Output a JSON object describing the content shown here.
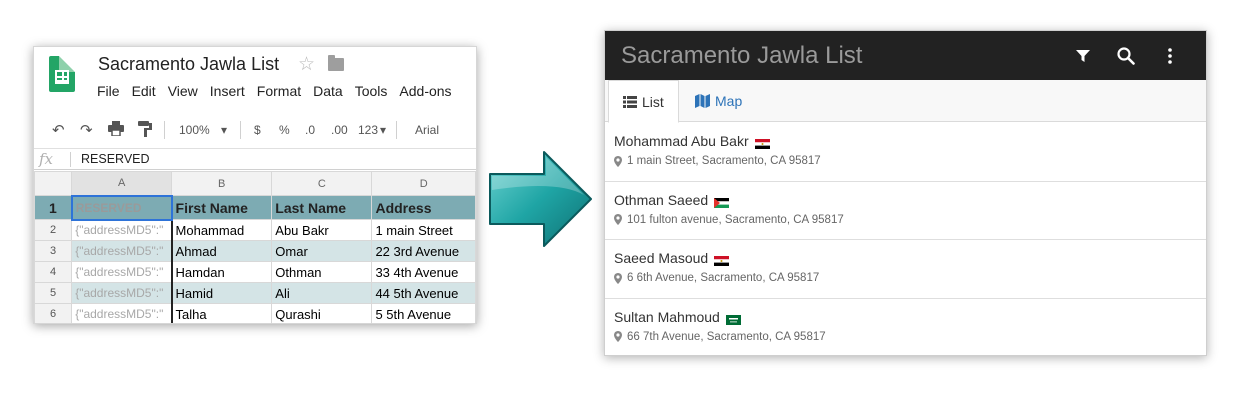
{
  "spreadsheet": {
    "title": "Sacramento Jawla List",
    "menu": [
      "File",
      "Edit",
      "View",
      "Insert",
      "Format",
      "Data",
      "Tools",
      "Add-ons"
    ],
    "toolbar": {
      "zoom": "100%",
      "currency": "$",
      "percent": "%",
      "decrease_decimal": ".0",
      "increase_decimal": ".00",
      "number_format": "123",
      "font": "Arial"
    },
    "formula_bar": {
      "fx": "fx",
      "value": "RESERVED"
    },
    "columns": [
      "A",
      "B",
      "C",
      "D"
    ],
    "header_row": {
      "num": "1",
      "cells": [
        "RESERVED",
        "First Name",
        "Last Name",
        "Address"
      ]
    },
    "rows": [
      {
        "num": "2",
        "cells": [
          "{\"addressMD5\":\"",
          "Mohammad",
          "Abu Bakr",
          "1 main Street"
        ],
        "band": false
      },
      {
        "num": "3",
        "cells": [
          "{\"addressMD5\":\"",
          "Ahmad",
          "Omar",
          "22 3rd Avenue"
        ],
        "band": true
      },
      {
        "num": "4",
        "cells": [
          "{\"addressMD5\":\"",
          "Hamdan",
          "Othman",
          "33 4th Avenue"
        ],
        "band": false
      },
      {
        "num": "5",
        "cells": [
          "{\"addressMD5\":\"",
          "Hamid",
          "Ali",
          "44 5th Avenue"
        ],
        "band": true
      },
      {
        "num": "6",
        "cells": [
          "{\"addressMD5\":\"",
          "Talha",
          "Qurashi",
          "5 5th Avenue"
        ],
        "band": false
      }
    ]
  },
  "app": {
    "title": "Sacramento Jawla List",
    "icons": [
      "filter-icon",
      "search-icon",
      "more-vert-icon"
    ],
    "tabs": [
      {
        "label": "List",
        "icon": "list-icon",
        "active": true
      },
      {
        "label": "Map",
        "icon": "map-icon",
        "active": false
      }
    ],
    "items": [
      {
        "name": "Mohammad Abu Bakr",
        "flag": "egypt",
        "address": "1 main Street, Sacramento, CA 95817"
      },
      {
        "name": "Othman Saeed",
        "flag": "palestine",
        "address": "101 fulton avenue, Sacramento, CA 95817"
      },
      {
        "name": "Saeed Masoud",
        "flag": "egypt",
        "address": "6 6th Avenue, Sacramento, CA 95817"
      },
      {
        "name": "Sultan Mahmoud",
        "flag": "saudi-arabia",
        "address": "66 7th Avenue, Sacramento, CA 95817"
      }
    ]
  },
  "colors": {
    "header_teal": "#7dabb3",
    "band_teal": "#d4e4e6",
    "appbar": "#222222",
    "link_blue": "#2d73b8",
    "arrow_teal": "#1fa5a5"
  }
}
